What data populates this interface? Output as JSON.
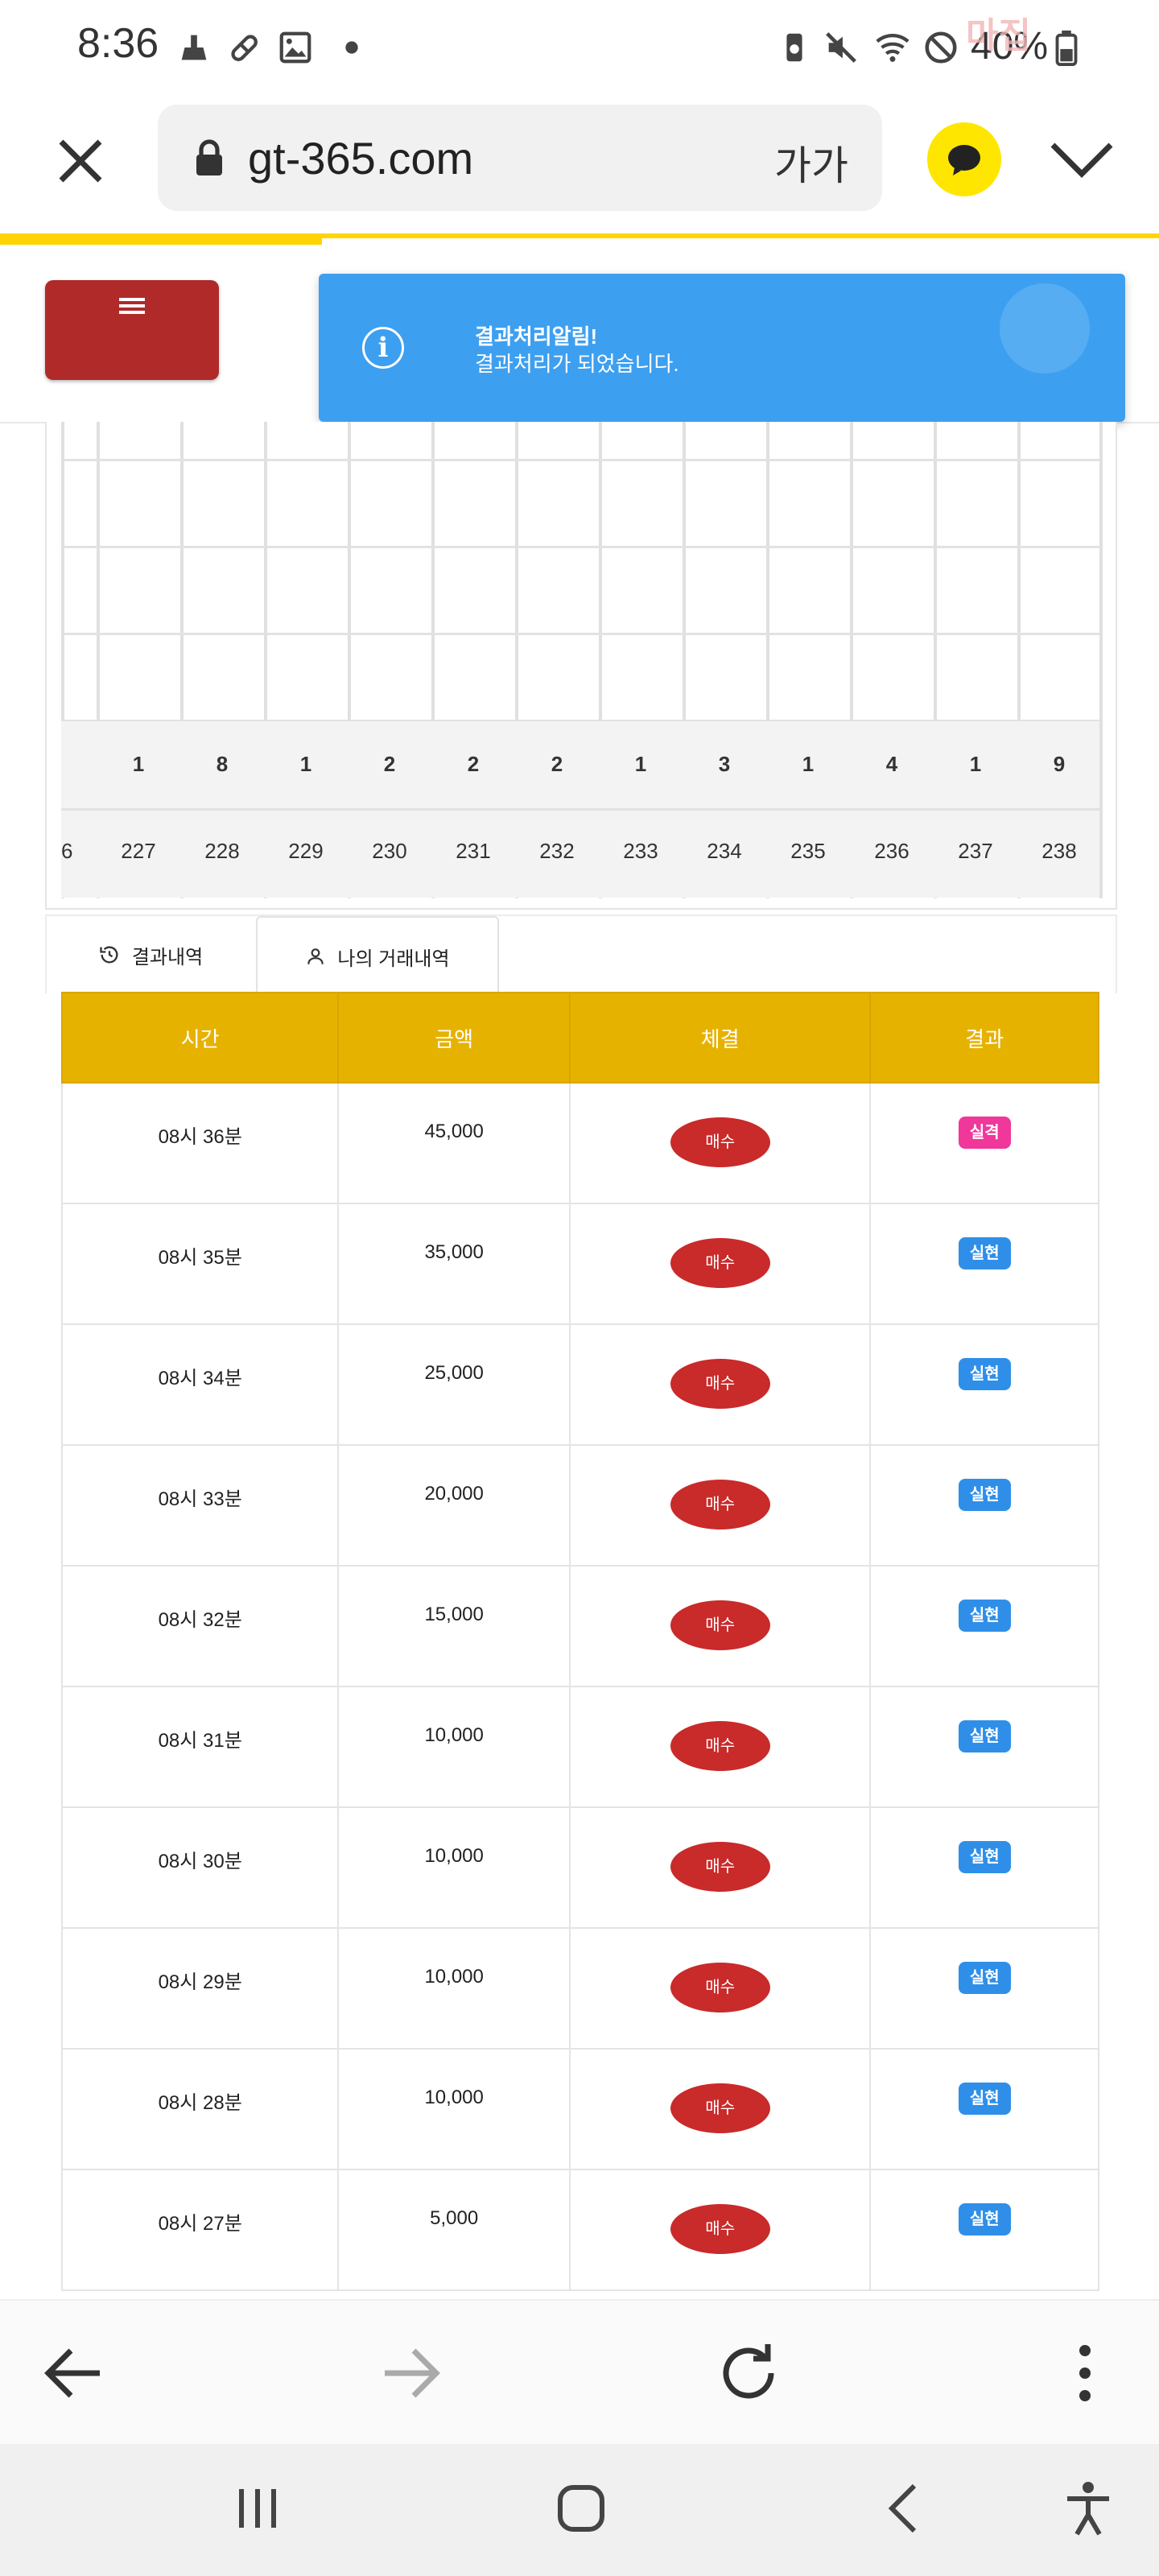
{
  "status_bar": {
    "time": "8:36",
    "battery_pct": "40%",
    "watermark": "마집"
  },
  "browser": {
    "url": "gt-365.com",
    "text_size_label": "가가",
    "load_progress": 0.278
  },
  "toast": {
    "title": "결과처리알림!",
    "message": "결과처리가 되었습니다.",
    "color": "#3d9ff0"
  },
  "grid": {
    "counts": [
      "1",
      "8",
      "1",
      "2",
      "2",
      "2",
      "1",
      "3",
      "1",
      "4",
      "1",
      "9"
    ],
    "rounds": [
      "6",
      "227",
      "228",
      "229",
      "230",
      "231",
      "232",
      "233",
      "234",
      "235",
      "236",
      "237",
      "238"
    ]
  },
  "tabs": {
    "results_label": "결과내역",
    "my_trades_label": "나의 거래내역"
  },
  "table": {
    "headers": {
      "time": "시간",
      "amount": "금액",
      "execution": "체결",
      "result": "결과"
    },
    "header_color": "#e6b200",
    "rows": [
      {
        "time": "08시 36분",
        "amount": "45,000",
        "execution": "매수",
        "result": "실격",
        "result_color": "#f0379a"
      },
      {
        "time": "08시 35분",
        "amount": "35,000",
        "execution": "매수",
        "result": "실현",
        "result_color": "#2f8fe8"
      },
      {
        "time": "08시 34분",
        "amount": "25,000",
        "execution": "매수",
        "result": "실현",
        "result_color": "#2f8fe8"
      },
      {
        "time": "08시 33분",
        "amount": "20,000",
        "execution": "매수",
        "result": "실현",
        "result_color": "#2f8fe8"
      },
      {
        "time": "08시 32분",
        "amount": "15,000",
        "execution": "매수",
        "result": "실현",
        "result_color": "#2f8fe8"
      },
      {
        "time": "08시 31분",
        "amount": "10,000",
        "execution": "매수",
        "result": "실현",
        "result_color": "#2f8fe8"
      },
      {
        "time": "08시 30분",
        "amount": "10,000",
        "execution": "매수",
        "result": "실현",
        "result_color": "#2f8fe8"
      },
      {
        "time": "08시 29분",
        "amount": "10,000",
        "execution": "매수",
        "result": "실현",
        "result_color": "#2f8fe8"
      },
      {
        "time": "08시 28분",
        "amount": "10,000",
        "execution": "매수",
        "result": "실현",
        "result_color": "#2f8fe8"
      },
      {
        "time": "08시 27분",
        "amount": "5,000",
        "execution": "매수",
        "result": "실현",
        "result_color": "#2f8fe8"
      }
    ]
  },
  "icons": {
    "status": [
      "cleaner-icon",
      "pill-icon",
      "gallery-icon",
      "dot-icon",
      "recycle-battery-icon",
      "mute-icon",
      "wifi-icon",
      "no-disturb-icon",
      "battery-icon"
    ],
    "browser_bottom": [
      "back-arrow-icon",
      "forward-arrow-icon",
      "reload-icon",
      "more-vert-icon"
    ],
    "system_nav": [
      "recent-apps-icon",
      "home-icon",
      "back-icon",
      "accessibility-icon"
    ]
  }
}
